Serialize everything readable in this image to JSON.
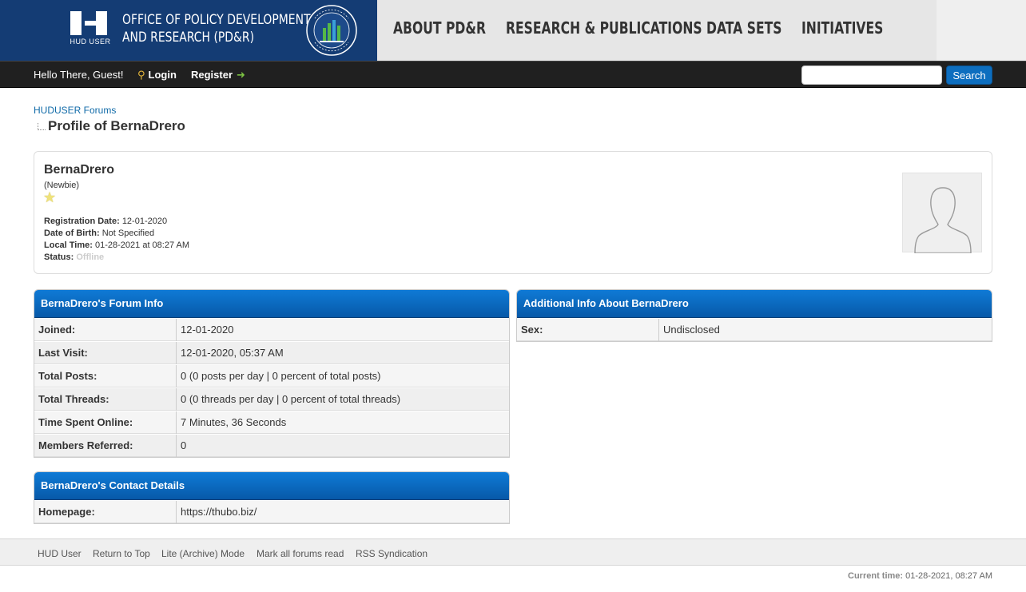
{
  "header": {
    "hud_logo_text": "HUD USER",
    "office_line1": "OFFICE OF POLICY DEVELOPMENT",
    "office_line2": "AND RESEARCH (PD&R)",
    "nav": [
      "ABOUT PD&R",
      "RESEARCH & PUBLICATIONS",
      "DATA SETS",
      "INITIATIVES"
    ]
  },
  "panel": {
    "greeting": "Hello There, Guest!",
    "login_label": "Login",
    "register_label": "Register",
    "search_placeholder": "",
    "search_button": "Search"
  },
  "breadcrumb": {
    "root": "HUDUSER Forums"
  },
  "page_title": "Profile of BernaDrero",
  "profile": {
    "username": "BernaDrero",
    "usertitle": "(Newbie)",
    "stars": 1,
    "fields": [
      {
        "label": "Registration Date:",
        "value": "12-01-2020"
      },
      {
        "label": "Date of Birth:",
        "value": "Not Specified"
      },
      {
        "label": "Local Time:",
        "value": "01-28-2021 at 08:27 AM"
      },
      {
        "label": "Status:",
        "value": "Offline"
      }
    ]
  },
  "forum_info": {
    "title": "BernaDrero's Forum Info",
    "rows": [
      {
        "label": "Joined:",
        "value": "12-01-2020"
      },
      {
        "label": "Last Visit:",
        "value": "12-01-2020, 05:37 AM"
      },
      {
        "label": "Total Posts:",
        "value": "0 (0 posts per day | 0 percent of total posts)"
      },
      {
        "label": "Total Threads:",
        "value": "0 (0 threads per day | 0 percent of total threads)"
      },
      {
        "label": "Time Spent Online:",
        "value": "7 Minutes, 36 Seconds"
      },
      {
        "label": "Members Referred:",
        "value": "0"
      }
    ]
  },
  "contact": {
    "title": "BernaDrero's Contact Details",
    "rows": [
      {
        "label": "Homepage:",
        "value": "https://thubo.biz/"
      }
    ]
  },
  "additional": {
    "title": "Additional Info About BernaDrero",
    "rows": [
      {
        "label": "Sex:",
        "value": "Undisclosed"
      }
    ]
  },
  "footer": {
    "links": [
      "HUD User",
      "Return to Top",
      "Lite (Archive) Mode",
      "Mark all forums read",
      "RSS Syndication"
    ],
    "current_time_label": "Current time:",
    "current_time": "01-28-2021, 08:27 AM"
  },
  "colors": {
    "brand_navy": "#143c74",
    "table_header_blue": "#0a6ac4",
    "link_blue": "#0f6aa8"
  }
}
